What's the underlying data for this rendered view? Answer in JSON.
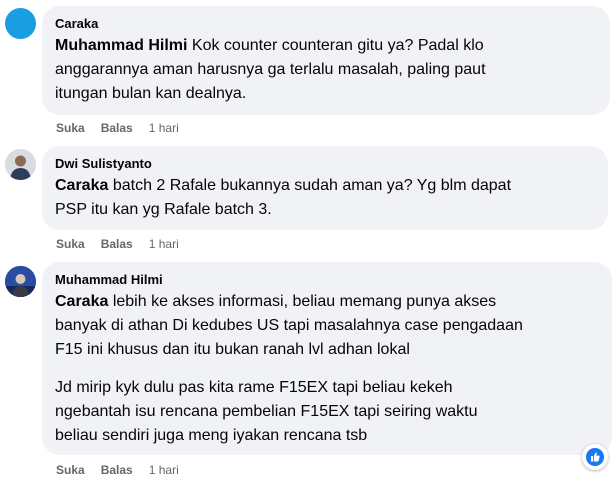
{
  "comments": [
    {
      "author": "Caraka",
      "mention": "Muhammad Hilmi",
      "lines": [
        " Kok counter counteran gitu ya? Padal klo",
        "anggarannya aman harusnya ga terlalu masalah, paling paut",
        "itungan bulan kan dealnya."
      ],
      "like": "Suka",
      "reply": "Balas",
      "time": "1 hari"
    },
    {
      "author": "Dwi Sulistyanto",
      "mention": "Caraka",
      "lines": [
        " batch 2 Rafale bukannya sudah aman ya? Yg blm dapat",
        "PSP itu kan yg Rafale batch 3."
      ],
      "like": "Suka",
      "reply": "Balas",
      "time": "1 hari"
    },
    {
      "author": "Muhammad Hilmi",
      "mention": "Caraka",
      "lines": [
        " lebih ke akses informasi, beliau memang punya akses",
        "banyak di athan Di kedubes US tapi masalahnya case pengadaan",
        "F15 ini khusus dan itu bukan ranah lvl adhan lokal"
      ],
      "paragraph2": [
        "Jd mirip kyk dulu pas kita rame F15EX tapi beliau kekeh",
        "ngebantah isu rencana pembelian F15EX tapi seiring waktu",
        "beliau sendiri juga meng iyakan rencana tsb"
      ],
      "like": "Suka",
      "reply": "Balas",
      "time": "1 hari"
    }
  ],
  "colors": {
    "bubble": "#f0f2f5",
    "secondary_text": "#65676b",
    "accent_blue": "#1877f2",
    "avatar_caraka": "#1b9de2"
  },
  "icons": {
    "reaction": "thumbs-up-icon"
  }
}
